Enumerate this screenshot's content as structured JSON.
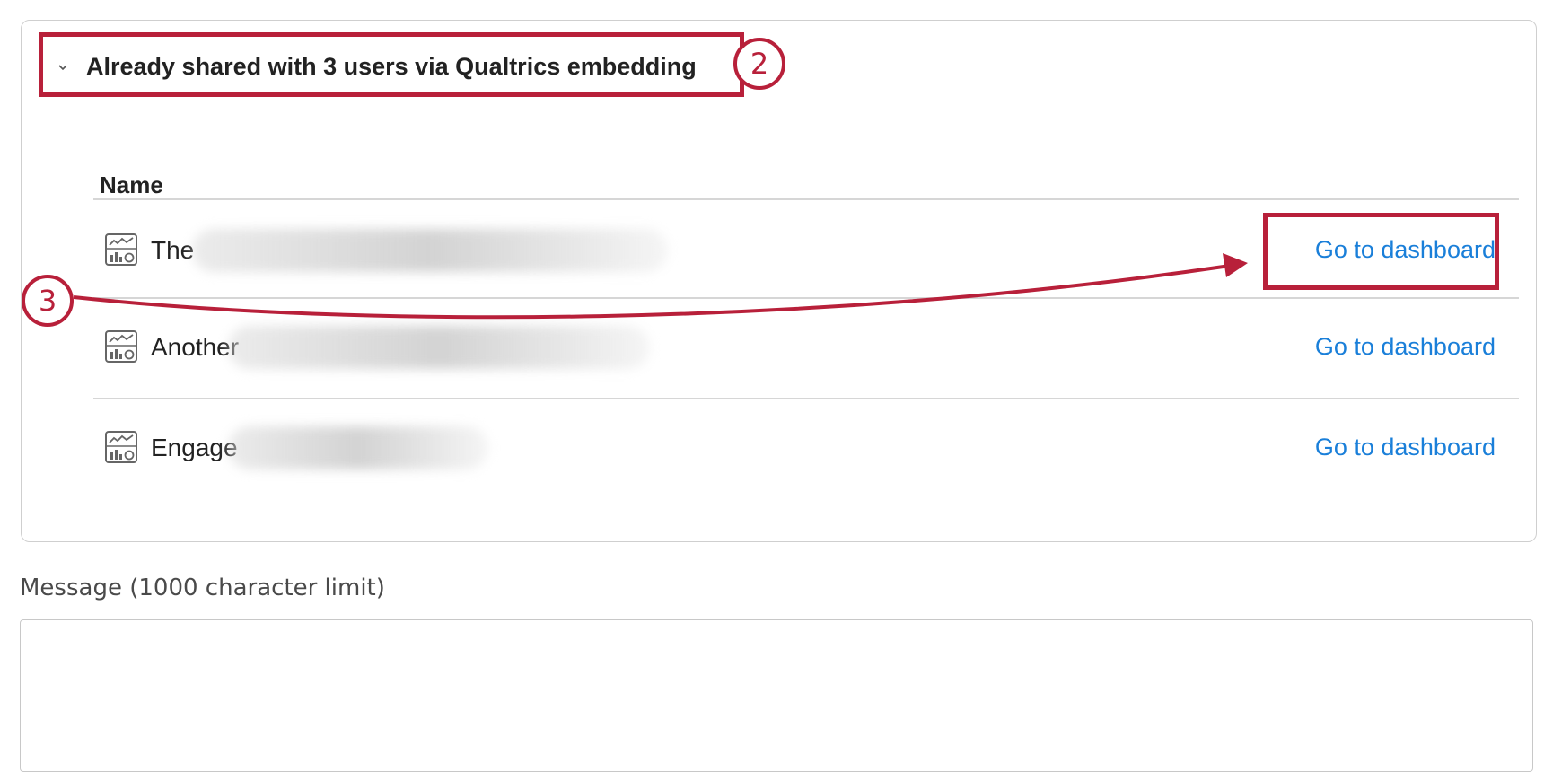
{
  "panel": {
    "header_text": "Already shared with 3 users via Qualtrics embedding",
    "column_header": "Name",
    "rows": [
      {
        "name": "The",
        "action": "Go to dashboard"
      },
      {
        "name": "Another",
        "action": "Go to dashboard"
      },
      {
        "name": "Engage",
        "action": "Go to dashboard"
      }
    ]
  },
  "callouts": [
    "2",
    "3"
  ],
  "message": {
    "label": "Message (1000 character limit)",
    "value": ""
  },
  "colors": {
    "annotation_red": "#b8203a",
    "link_blue": "#1a7fd9"
  },
  "icons": {
    "collapse": "chevron-down-icon",
    "dashboard": "dashboard-icon"
  }
}
